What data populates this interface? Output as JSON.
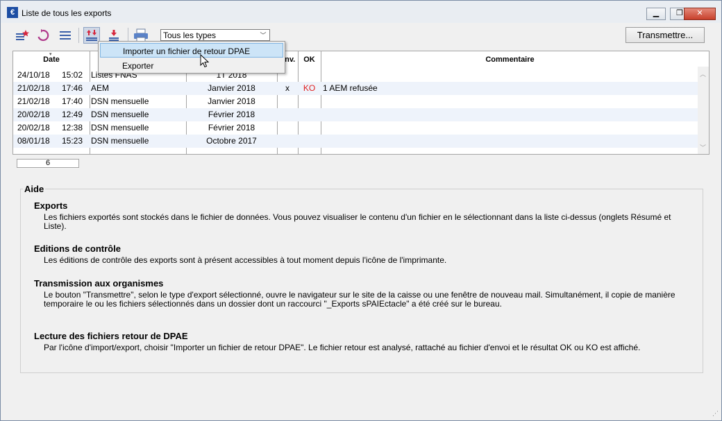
{
  "window": {
    "title": "Liste de tous les exports",
    "app_icon": "€"
  },
  "toolbar": {
    "icons": [
      "star-list-icon",
      "refresh-icon",
      "list-icon",
      "import-export-icon",
      "download-icon",
      "printer-icon"
    ],
    "filter": {
      "selected": "Tous les types"
    },
    "transmit_label": "Transmettre..."
  },
  "table": {
    "columns": {
      "date": "Date",
      "env": "Env.",
      "ok": "OK",
      "comment": "Commentaire"
    },
    "rows": [
      {
        "date": "24/10/18",
        "time": "15:02",
        "type": "Listes FNAS",
        "period": "1T 2018",
        "env": "",
        "ok": "",
        "comment": ""
      },
      {
        "date": "21/02/18",
        "time": "17:46",
        "type": "AEM",
        "period": "Janvier 2018",
        "env": "x",
        "ok": "KO",
        "comment": "1 AEM refusée"
      },
      {
        "date": "21/02/18",
        "time": "17:40",
        "type": "DSN mensuelle",
        "period": "Janvier 2018",
        "env": "",
        "ok": "",
        "comment": ""
      },
      {
        "date": "20/02/18",
        "time": "12:49",
        "type": "DSN mensuelle",
        "period": "Février 2018",
        "env": "",
        "ok": "",
        "comment": ""
      },
      {
        "date": "20/02/18",
        "time": "12:38",
        "type": "DSN mensuelle",
        "period": "Février 2018",
        "env": "",
        "ok": "",
        "comment": ""
      },
      {
        "date": "08/01/18",
        "time": "15:23",
        "type": "DSN mensuelle",
        "period": "Octobre 2017",
        "env": "",
        "ok": "",
        "comment": ""
      }
    ],
    "count": "6"
  },
  "menu": {
    "items": [
      {
        "label": "Importer un fichier de retour DPAE",
        "highlighted": true
      },
      {
        "label": "Exporter",
        "highlighted": false
      }
    ]
  },
  "help": {
    "title": "Aide",
    "sections": [
      {
        "title": "Exports",
        "body": "Les fichiers exportés sont stockés dans le fichier de données. Vous pouvez visualiser le contenu d'un fichier en le sélectionnant dans la liste ci-dessus (onglets Résumé et Liste)."
      },
      {
        "title": "Editions de contrôle",
        "body": "Les éditions de contrôle des exports sont à présent accessibles à tout moment depuis l'icône de l'imprimante."
      },
      {
        "title": "Transmission aux organismes",
        "body": "Le bouton \"Transmettre\", selon le type d'export sélectionné, ouvre le navigateur sur le site de la caisse ou une fenêtre de nouveau mail. Simultanément, il copie de manière temporaire le ou les fichiers sélectionnés dans un dossier dont un raccourci \"_Exports sPAIEctacle\" a été créé sur le bureau."
      },
      {
        "title": "Lecture des fichiers retour de DPAE",
        "body": "Par l'icône d'import/export, choisir \"Importer un fichier de retour DPAE\". Le fichier retour est analysé, rattaché au fichier d'envoi et le résultat OK ou KO est affiché."
      }
    ]
  },
  "colors": {
    "ko": "#e02020",
    "highlight": "#cce4f7",
    "alt_row": "#eef3fb"
  }
}
